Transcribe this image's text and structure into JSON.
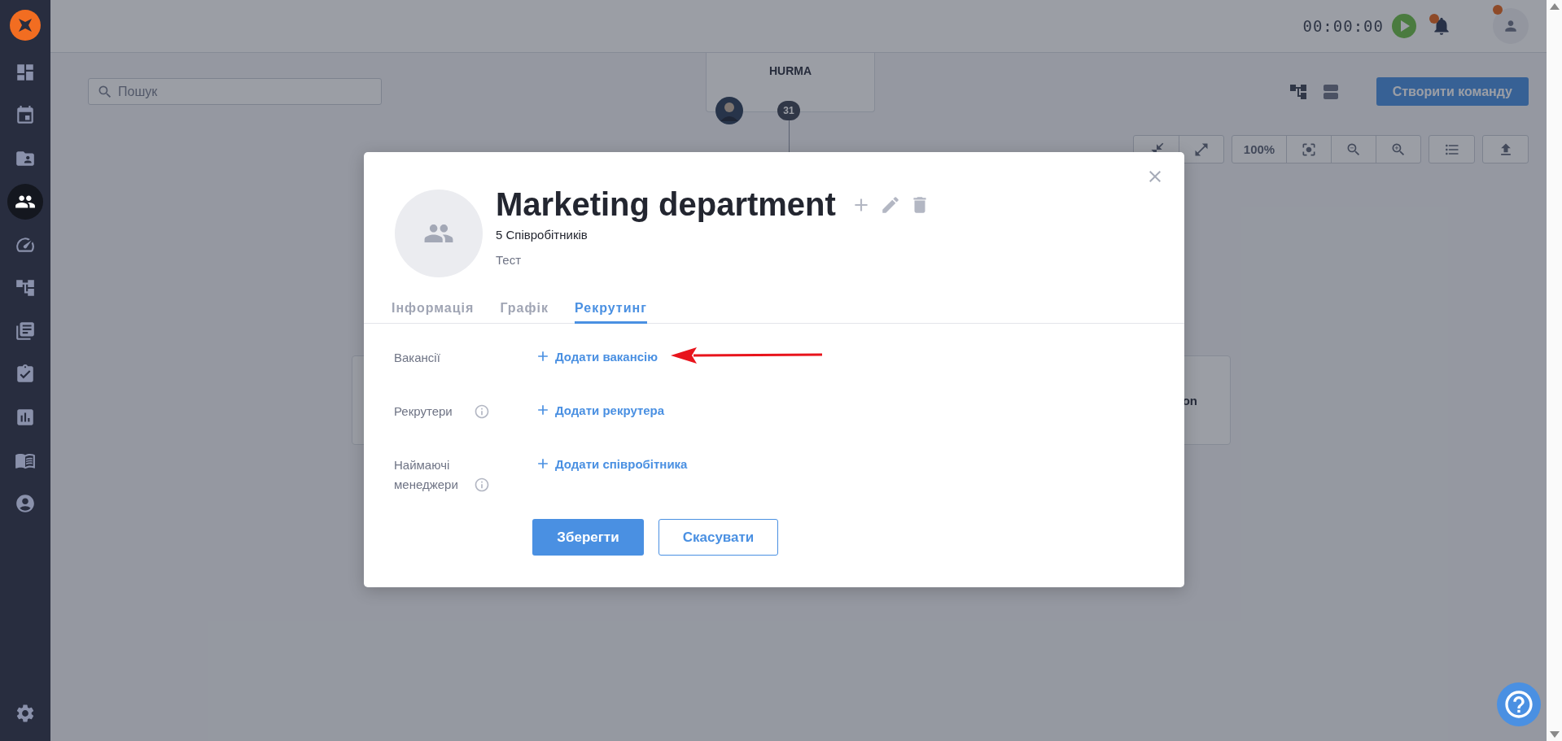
{
  "sidebar": {
    "items": [
      {
        "selected": false
      },
      {
        "selected": false
      },
      {
        "selected": false
      },
      {
        "selected": true
      },
      {
        "selected": false
      },
      {
        "selected": false
      },
      {
        "selected": false
      },
      {
        "selected": false
      },
      {
        "selected": false
      },
      {
        "selected": false
      },
      {
        "selected": false
      }
    ]
  },
  "top_bar": {
    "timer": "00:00:00"
  },
  "toolbar": {
    "search": {
      "placeholder": "Пошук"
    },
    "create_button": "Створити команду",
    "zoom_level": "100%"
  },
  "org_chart": {
    "root": {
      "name": "HURMA",
      "count": "31"
    },
    "node_text": "on"
  },
  "modal": {
    "title": "Marketing department",
    "members": "5 Співробітників",
    "description": "Тест",
    "tabs": [
      {
        "label": "Інформація",
        "selected": false
      },
      {
        "label": "Графік",
        "selected": false
      },
      {
        "label": "Рекрутинг",
        "selected": true
      }
    ],
    "rows": [
      {
        "label": "Вакансії",
        "info": false,
        "action": "Додати вакансію"
      },
      {
        "label": "Рекрутери",
        "info": true,
        "action": "Додати рекрутера"
      },
      {
        "label": "Наймаючі менеджери",
        "info": true,
        "action": "Додати співробітника"
      }
    ],
    "buttons": {
      "save": "Зберегти",
      "cancel": "Скасувати"
    }
  }
}
